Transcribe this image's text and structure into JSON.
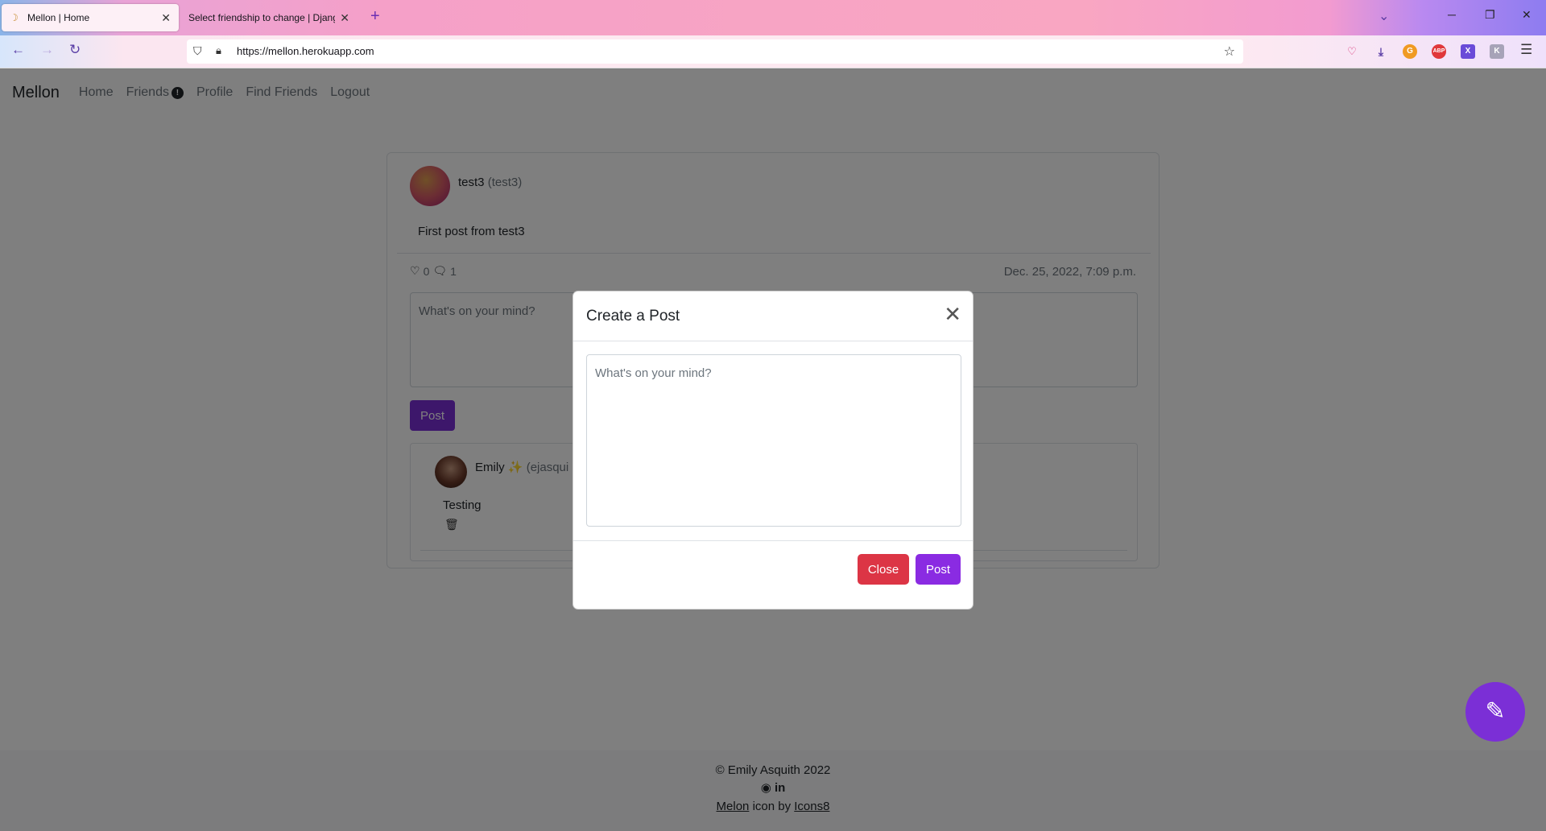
{
  "browser": {
    "tabs": [
      {
        "title": "Mellon | Home",
        "active": true
      },
      {
        "title": "Select friendship to change | Django",
        "active": false
      }
    ],
    "new_tab_label": "+",
    "url": "https://mellon.herokuapp.com",
    "extensions": [
      "pocket-icon",
      "download-icon",
      "grammarly-icon",
      "adblock-icon",
      "x-extension-icon",
      "k-extension-icon"
    ]
  },
  "site": {
    "brand": "Mellon",
    "nav": {
      "home": "Home",
      "friends": "Friends",
      "friends_badge": "!",
      "profile": "Profile",
      "find_friends": "Find Friends",
      "logout": "Logout"
    }
  },
  "post": {
    "author_name": "test3",
    "author_handle": "(test3)",
    "text": "First post from test3",
    "likes": "0",
    "comments": "1",
    "date": "Dec. 25, 2022, 7:09 p.m.",
    "comment_placeholder": "What's on your mind?",
    "post_button": "Post"
  },
  "comment": {
    "author_name": "Emily",
    "author_emoji": "✨",
    "author_handle": "(ejasqui",
    "text": "Testing"
  },
  "footer": {
    "copyright": "© Emily Asquith 2022",
    "social": "in",
    "credit_link1": "Melon",
    "credit_mid": "icon by",
    "credit_link2": "Icons8"
  },
  "modal": {
    "title": "Create a Post",
    "placeholder": "What's on your mind?",
    "close_button": "Close",
    "post_button": "Post"
  },
  "colors": {
    "primary_purple": "#8a2be2",
    "danger_red": "#dc3545"
  }
}
